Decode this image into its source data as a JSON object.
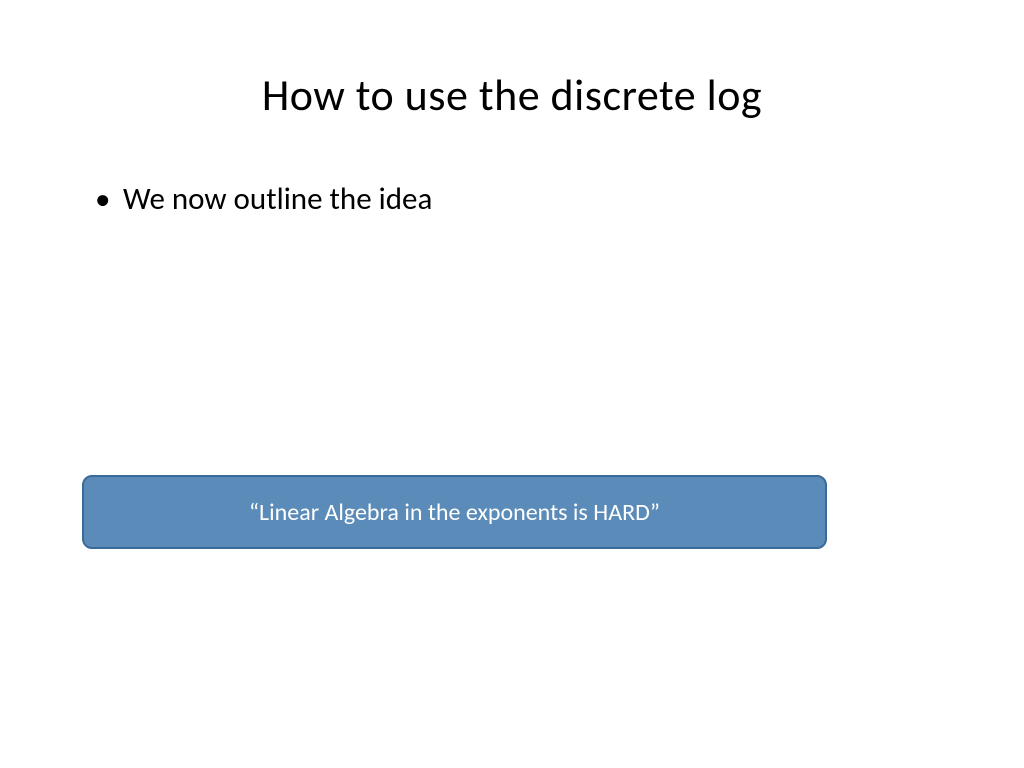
{
  "title": "How to use the discrete log",
  "bullets": {
    "item1": "We now outline the idea"
  },
  "callout": {
    "text": "“Linear Algebra in the exponents is HARD”"
  }
}
